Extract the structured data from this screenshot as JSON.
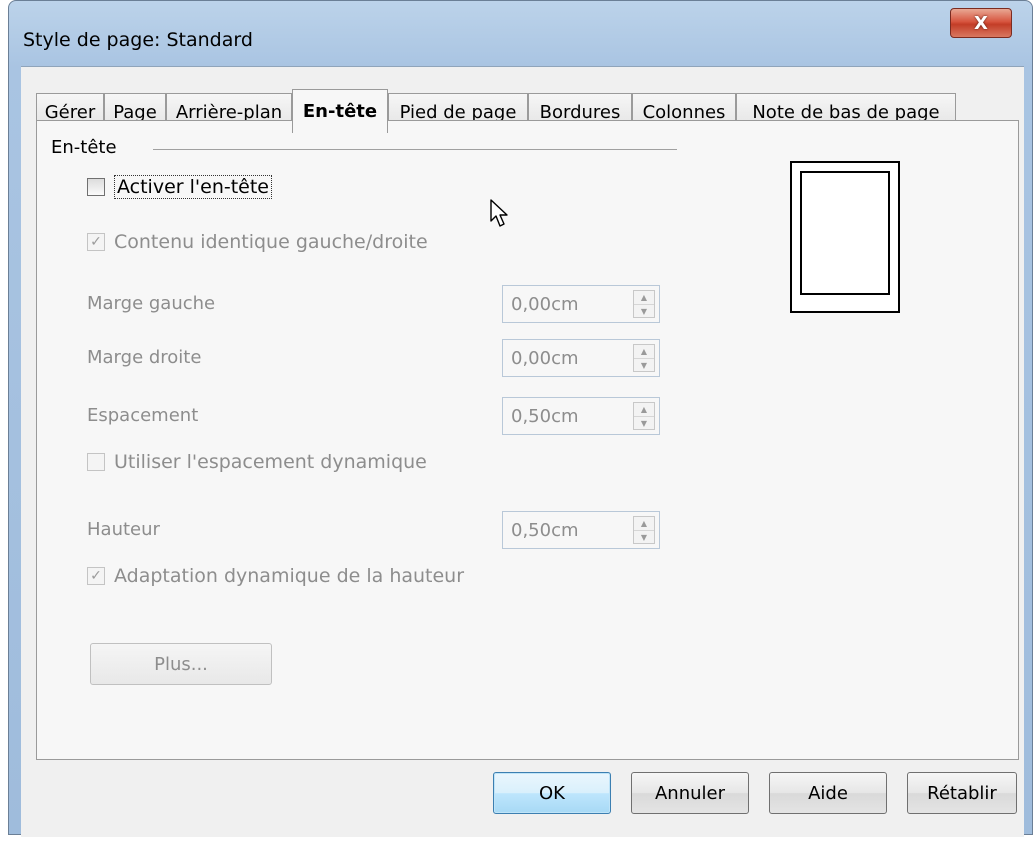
{
  "window": {
    "title": "Style de page: Standard",
    "close_glyph": "X"
  },
  "tabs": [
    {
      "label": "Gérer"
    },
    {
      "label": "Page"
    },
    {
      "label": "Arrière-plan"
    },
    {
      "label": "En-tête",
      "active": true
    },
    {
      "label": "Pied de page"
    },
    {
      "label": "Bordures"
    },
    {
      "label": "Colonnes"
    },
    {
      "label": "Note de bas de page"
    }
  ],
  "header_group": {
    "label": "En-tête",
    "activate": {
      "label": "Activer l'en-tête",
      "checked": false
    },
    "same_content": {
      "label": "Contenu identique gauche/droite",
      "checked": true,
      "disabled": true
    },
    "left_margin": {
      "label": "Marge gauche",
      "value": "0,00cm"
    },
    "right_margin": {
      "label": "Marge droite",
      "value": "0,00cm"
    },
    "spacing": {
      "label": "Espacement",
      "value": "0,50cm"
    },
    "dynamic_spacing": {
      "label": "Utiliser l'espacement dynamique",
      "checked": false,
      "disabled": true
    },
    "height": {
      "label": "Hauteur",
      "value": "0,50cm"
    },
    "autofit_height": {
      "label": "Adaptation dynamique de la hauteur",
      "checked": true,
      "disabled": true
    },
    "more_button": "Plus..."
  },
  "buttons": {
    "ok": "OK",
    "cancel": "Annuler",
    "help": "Aide",
    "reset": "Rétablir"
  },
  "colors": {
    "titlebar": "#a9c4e2",
    "close": "#c33d27",
    "default_button": "#a7d9f5",
    "disabled_text": "#8d8d8d"
  }
}
